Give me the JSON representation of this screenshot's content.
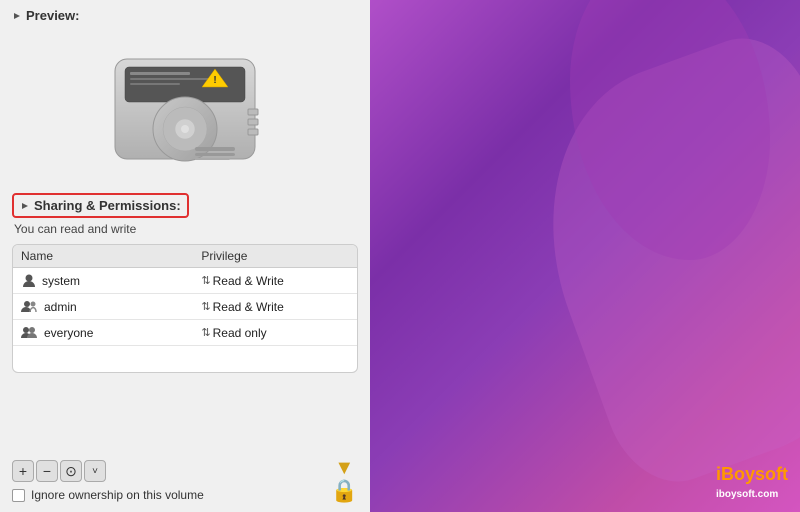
{
  "leftPanel": {
    "preview": {
      "header": "Preview:"
    },
    "sharing": {
      "header": "Sharing & Permissions:",
      "subtitle": "You can read and write",
      "table": {
        "columns": [
          "Name",
          "Privilege"
        ],
        "rows": [
          {
            "name": "system",
            "privilege": "Read & Write",
            "icon": "single-user"
          },
          {
            "name": "admin",
            "privilege": "Read & Write",
            "icon": "group-user"
          },
          {
            "name": "everyone",
            "privilege": "Read only",
            "icon": "group-user"
          }
        ]
      },
      "actions": [
        "+",
        "−",
        "⊙",
        "˅"
      ],
      "ownershipLabel": "Ignore ownership on this volume"
    }
  },
  "rightPanel": {
    "watermark": {
      "brand": "iBoysoft",
      "domain": "iboysoft.com"
    }
  }
}
